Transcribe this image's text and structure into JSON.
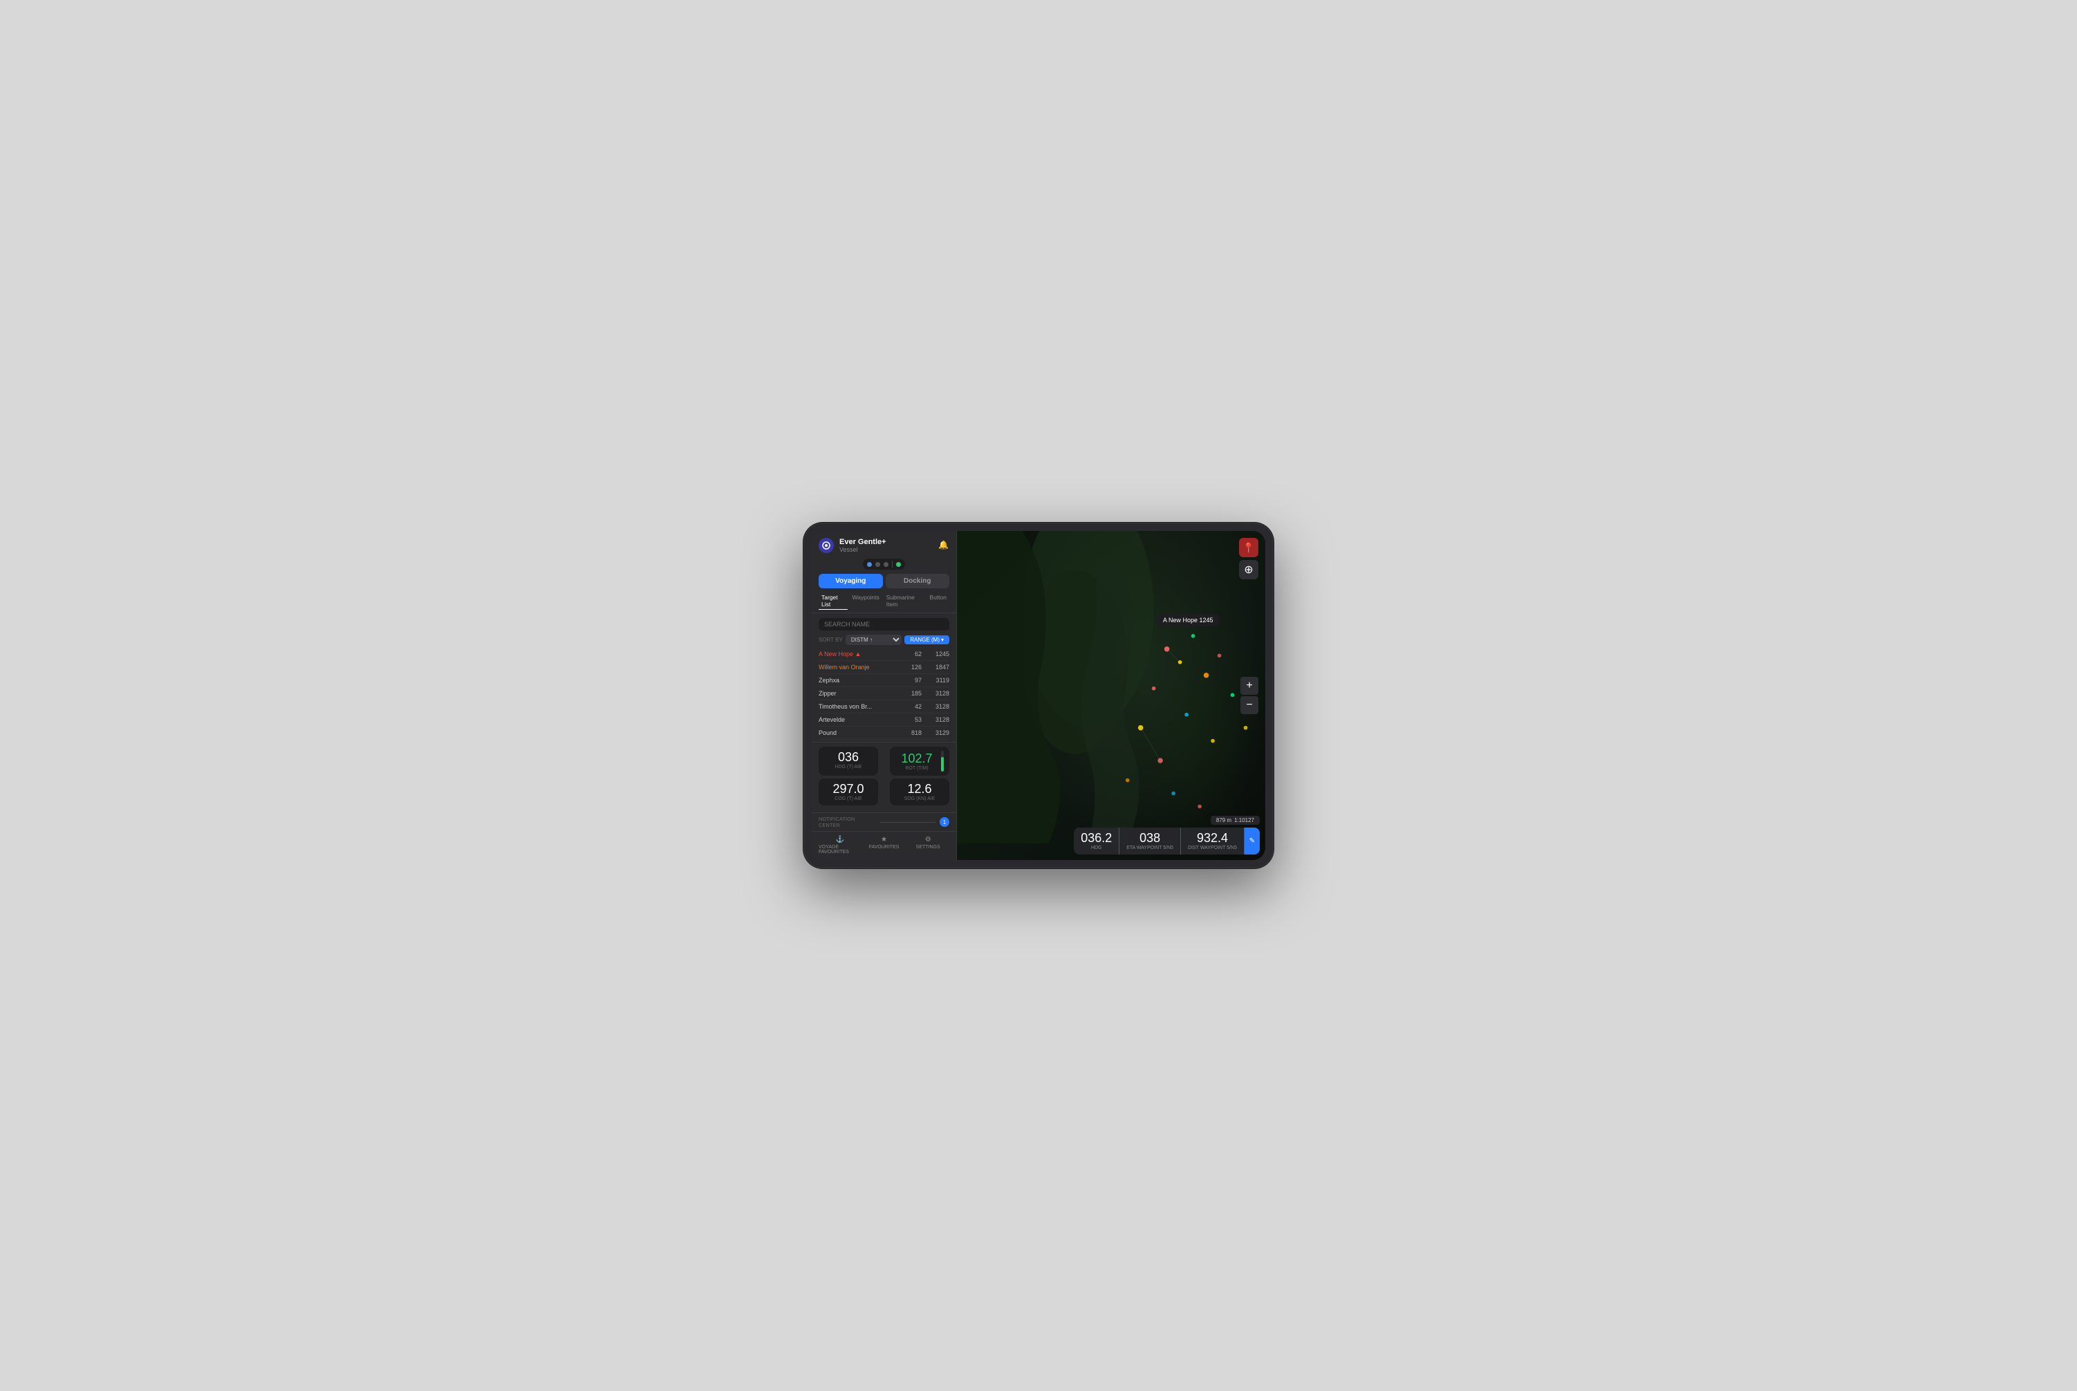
{
  "tablet": {
    "vessel_name": "Ever Gentle+",
    "vessel_subtitle": "Vessel",
    "bell_icon": "🔔",
    "connection_status": "Connected"
  },
  "tabs": {
    "voyaging": "Voyaging",
    "docking": "Docking"
  },
  "sub_tabs": {
    "target_list": "Target List",
    "waypoints": "Waypoints",
    "submarine_item": "Submarine Item",
    "buton": "Button"
  },
  "search": {
    "placeholder": "SEARCH NAME"
  },
  "sort": {
    "label": "SORT BY",
    "option": "DISTM ↑",
    "range_label": "RANGE (M)"
  },
  "targets": [
    {
      "name": "A New Hope",
      "alert": true,
      "value": "62",
      "range": "1245",
      "color": "red"
    },
    {
      "name": "Willem van Oranje",
      "alert": false,
      "value": "126",
      "range": "1847",
      "color": "orange"
    },
    {
      "name": "Zephxa",
      "alert": false,
      "value": "97",
      "range": "3119",
      "color": "normal"
    },
    {
      "name": "Zipper",
      "alert": false,
      "value": "185",
      "range": "3128",
      "color": "normal"
    },
    {
      "name": "Timotheus von Br...",
      "alert": false,
      "value": "42",
      "range": "3128",
      "color": "normal"
    },
    {
      "name": "Artevelde",
      "alert": false,
      "value": "53",
      "range": "3128",
      "color": "normal"
    },
    {
      "name": "Pound",
      "alert": false,
      "value": "818",
      "range": "3129",
      "color": "normal"
    }
  ],
  "gauges": {
    "hdg": {
      "value": "036",
      "label": "HDG (T) AIE"
    },
    "rot": {
      "value": "102.7",
      "label": "ROT (T/M)",
      "bar_percent": 70
    },
    "cog": {
      "value": "297.0",
      "label": "COG (T) AIE"
    },
    "sog": {
      "value": "12.6",
      "label": "SOG (KN) AIE"
    }
  },
  "notification": {
    "label": "NOTIFICATION CENTER",
    "badge": "1"
  },
  "bottom_nav": [
    {
      "icon": "⚓",
      "label": "VOYAGE FAVOURITES"
    },
    {
      "icon": "★",
      "label": "FAVOURITES"
    },
    {
      "icon": "⚙",
      "label": "SETTINGS"
    }
  ],
  "map": {
    "ship_popup": "A New Hope 1245",
    "scale": "879 m",
    "scale_ratio": "1:10127",
    "data_overlay": {
      "hdg": {
        "value": "036.2",
        "sub": "HDG"
      },
      "eta": {
        "value": "038",
        "sub": "ETA WAYPOINT 5/N5"
      },
      "dist": {
        "value": "932.4",
        "sub": "DIST WAYPOINT 5/N5"
      }
    }
  },
  "icons": {
    "zoom_in": "+",
    "zoom_out": "−",
    "location": "📍",
    "compass": "⊕",
    "edit": "✎",
    "anchor": "⚓",
    "star": "★",
    "gear": "⚙"
  }
}
